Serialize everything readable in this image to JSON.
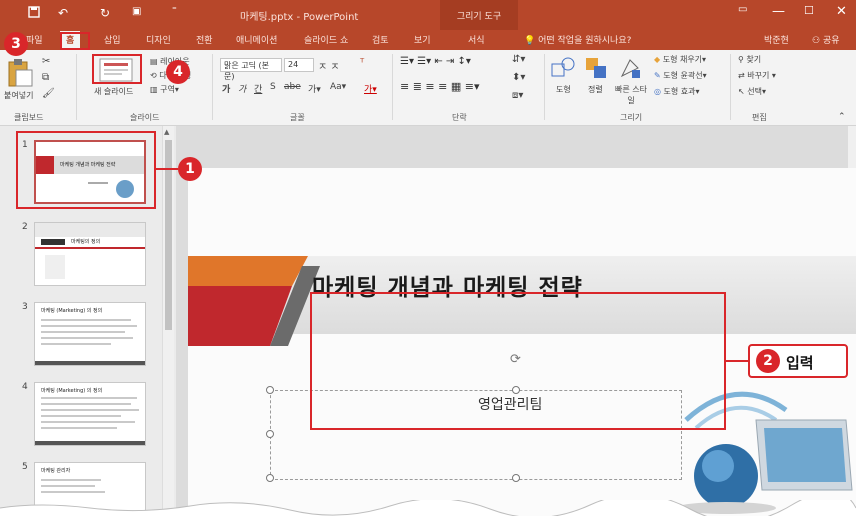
{
  "titlebar": {
    "title": "마케팅.pptx - PowerPoint",
    "context_tab": "그리기 도구",
    "save_icon": "save-icon",
    "undo_icon": "undo-icon",
    "redo_icon": "redo-icon"
  },
  "tabs": [
    "파일",
    "홈",
    "삽입",
    "디자인",
    "전환",
    "애니메이션",
    "슬라이드 쇼",
    "검토",
    "보기",
    "서식"
  ],
  "tell_me": "어떤 작업을 원하시나요?",
  "user_name": "박준현",
  "share": "공유",
  "ribbon": {
    "clipboard": {
      "paste": "붙여넣기",
      "group": "클립보드"
    },
    "slides": {
      "new_slide": "새 슬라이드",
      "layout": "레이아웃",
      "reset": "다시 설정",
      "section": "구역",
      "group": "슬라이드"
    },
    "font": {
      "font_name": "맑은 고딕 (본문)",
      "font_size": "24",
      "group": "글꼴"
    },
    "paragraph": {
      "group": "단락"
    },
    "drawing": {
      "shapes": "도형",
      "arrange": "정렬",
      "quick_styles": "빠른 스타일",
      "fill": "도형 채우기",
      "outline": "도형 윤곽선",
      "effects": "도형 효과",
      "group": "그리기"
    },
    "editing": {
      "find": "찾기",
      "replace": "바꾸기",
      "select": "선택",
      "group": "편집"
    }
  },
  "thumbnails": [
    {
      "num": "1",
      "title": "마케팅 개념과 마케팅 전략"
    },
    {
      "num": "2",
      "title": "마케팅의 정의"
    },
    {
      "num": "3",
      "title": "마케팅 (Marketing) 의 정의"
    },
    {
      "num": "4",
      "title": "마케팅 (Marketing) 의 정의"
    },
    {
      "num": "5",
      "title": "마케팅 관리자"
    }
  ],
  "slide": {
    "title": "마케팅 개념과 마케팅 전략",
    "subtitle": "영업관리팀"
  },
  "annotations": {
    "badge1": "1",
    "badge2": "2",
    "badge2_label": "입력",
    "badge3": "3",
    "badge4": "4"
  },
  "colors": {
    "accent": "#b7472a",
    "annotation_red": "#d9262a",
    "slide_orange": "#e0762a",
    "slide_red": "#c0282d"
  }
}
